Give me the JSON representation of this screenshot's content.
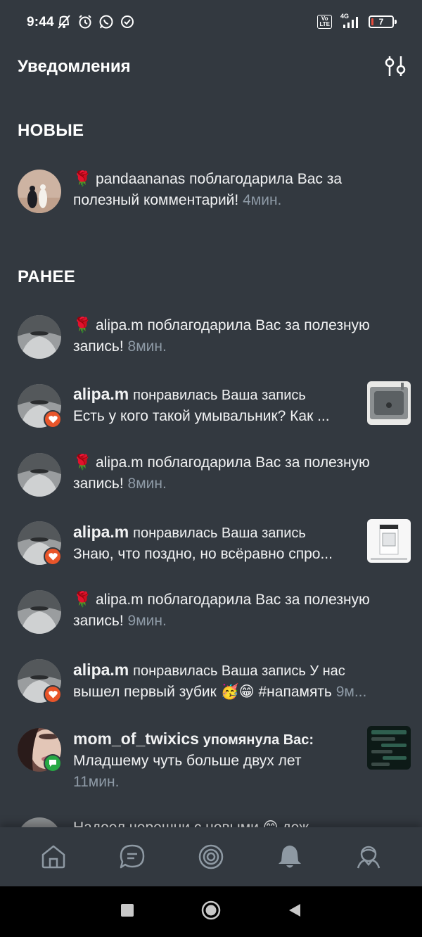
{
  "status_bar": {
    "time": "9:44",
    "volte": "Vo\nLTE",
    "network": "4G",
    "battery": "7"
  },
  "header": {
    "title": "Уведомления"
  },
  "sections": {
    "new_title": "НОВЫЕ",
    "earlier_title": "РАНЕЕ"
  },
  "notifications": [
    {
      "user": "pandaananas",
      "line1": "🌹 pandaananas поблагодарила Вас за",
      "line2": "полезный комментарий!",
      "time": "4мин."
    },
    {
      "user": "alipa.m",
      "line1": "🌹 alipa.m поблагодарила Вас за полезную",
      "line2": "запись!",
      "time": "8мин."
    },
    {
      "user": "alipa.m",
      "action": "понравилась Ваша запись",
      "line2": "Есть у кого такой умывальник? Как ..."
    },
    {
      "user": "alipa.m",
      "line1": "🌹 alipa.m поблагодарила Вас за полезную",
      "line2": "запись!",
      "time": "8мин."
    },
    {
      "user": "alipa.m",
      "action": "понравилась Ваша запись",
      "line2": "Знаю, что поздно, но всёравно спро..."
    },
    {
      "user": "alipa.m",
      "line1": "🌹 alipa.m поблагодарила Вас за полезную",
      "line2": "запись!",
      "time": "9мин."
    },
    {
      "user": "alipa.m",
      "action": "понравилась Ваша запись У нас",
      "line2": "вышел первый зубик 🥳😁 #напамять",
      "time": "9м..."
    },
    {
      "user": "mom_of_twixics",
      "action": "упомянула Вас:",
      "line2": "Младшему чуть больше двух лет",
      "time": "11мин."
    }
  ],
  "peek_text": "Надоел черешни с новыми 😊 деж",
  "icons": {
    "filter": "sliders-icon",
    "nav": [
      "home-icon",
      "chat-icon",
      "target-icon",
      "bell-icon",
      "profile-icon"
    ],
    "like_badge": "heart-icon",
    "mention_badge": "speech-bubble-icon"
  },
  "colors": {
    "background": "#333940",
    "time_text": "#8e9aa6",
    "like_badge": "#e8552a",
    "mention_badge": "#27a844",
    "battery_low": "#e74c3c"
  }
}
